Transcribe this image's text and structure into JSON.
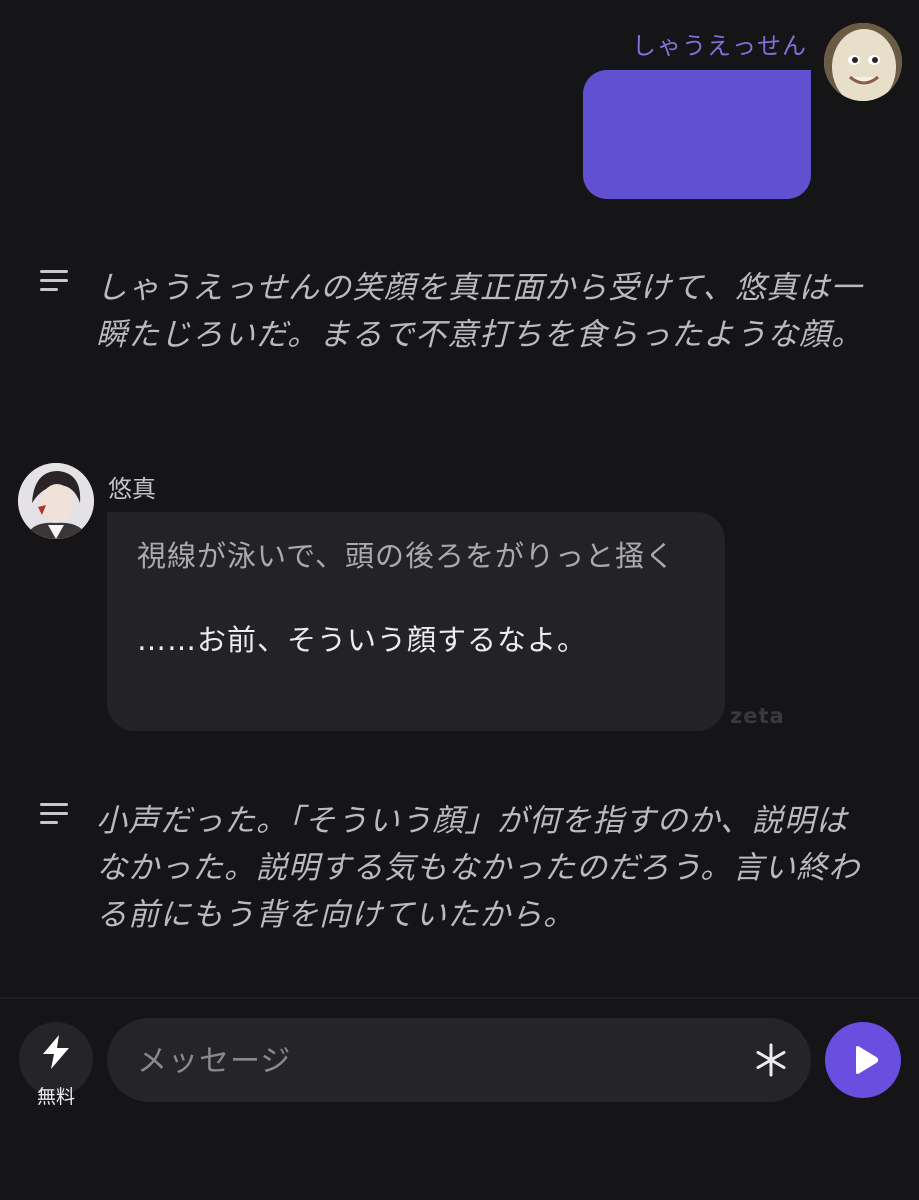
{
  "user_message": {
    "name": "しゃうえっせん",
    "avatar_icon": "smiling-face-avatar",
    "bubble_color": "#6150d0"
  },
  "narration_1": {
    "icon": "lines-icon",
    "text": "しゃうえっせんの笑顔を真正面から受けて、悠真は一瞬たじろいだ。まるで不意打ちを食らったような顔。"
  },
  "bot_message": {
    "name": "悠真",
    "avatar_icon": "character-avatar",
    "action": "視線が泳いで、頭の後ろをがりっと掻く",
    "speech": "……お前、そういう顔するなよ。",
    "watermark": "zeta"
  },
  "narration_2": {
    "icon": "lines-icon",
    "text": "小声だった。「そういう顔」が何を指すのか、説明はなかった。説明する気もなかったのだろう。言い終わる前にもう背を向けていたから。"
  },
  "input_bar": {
    "boost_label": "無料",
    "boost_icon": "lightning-icon",
    "placeholder": "メッセージ",
    "value": "",
    "asterisk_icon": "asterisk-icon",
    "send_icon": "play-icon",
    "send_color": "#6a4ee0"
  }
}
